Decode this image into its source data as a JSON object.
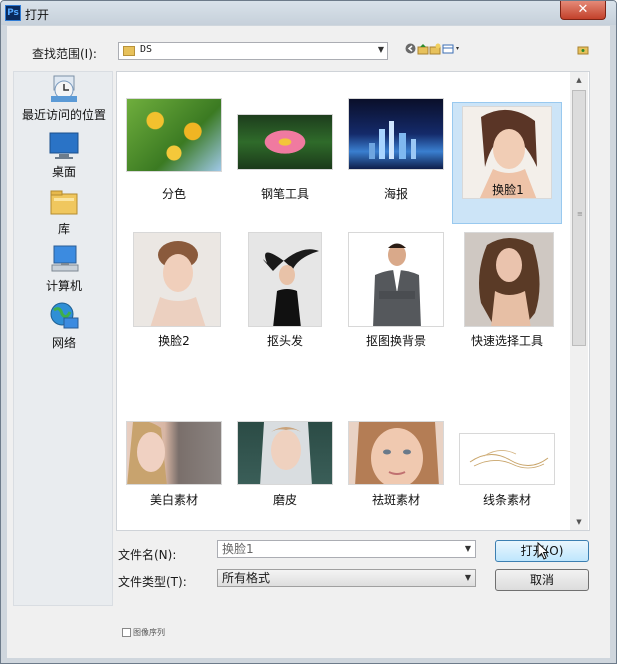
{
  "window": {
    "title": "打开",
    "app_icon": "Ps",
    "close_symbol": "✕"
  },
  "toolbar": {
    "look_in_label": "查找范围(I):",
    "look_in_value": "DS",
    "icons": [
      "back-icon",
      "up-folder-icon",
      "new-folder-icon",
      "view-menu-icon"
    ]
  },
  "places": [
    {
      "label": "最近访问的位置",
      "icon": "recent-places-icon"
    },
    {
      "label": "桌面",
      "icon": "desktop-icon"
    },
    {
      "label": "库",
      "icon": "libraries-icon"
    },
    {
      "label": "计算机",
      "icon": "computer-icon"
    },
    {
      "label": "网络",
      "icon": "network-icon"
    }
  ],
  "files": [
    {
      "name": "分色",
      "selected": false
    },
    {
      "name": "钢笔工具",
      "selected": false
    },
    {
      "name": "海报",
      "selected": false
    },
    {
      "name": "换脸1",
      "selected": true
    },
    {
      "name": "换脸2",
      "selected": false
    },
    {
      "name": "抠头发",
      "selected": false
    },
    {
      "name": "抠图换背景",
      "selected": false
    },
    {
      "name": "快速选择工具",
      "selected": false
    },
    {
      "name": "美白素材",
      "selected": false
    },
    {
      "name": "磨皮",
      "selected": false
    },
    {
      "name": "祛斑素材",
      "selected": false
    },
    {
      "name": "线条素材",
      "selected": false
    }
  ],
  "form": {
    "filename_label": "文件名(N):",
    "filename_value": "换脸1",
    "filetype_label": "文件类型(T):",
    "filetype_value": "所有格式",
    "open_button": "打开(O)",
    "cancel_button": "取消",
    "image_sequence_label": "图像序列"
  }
}
